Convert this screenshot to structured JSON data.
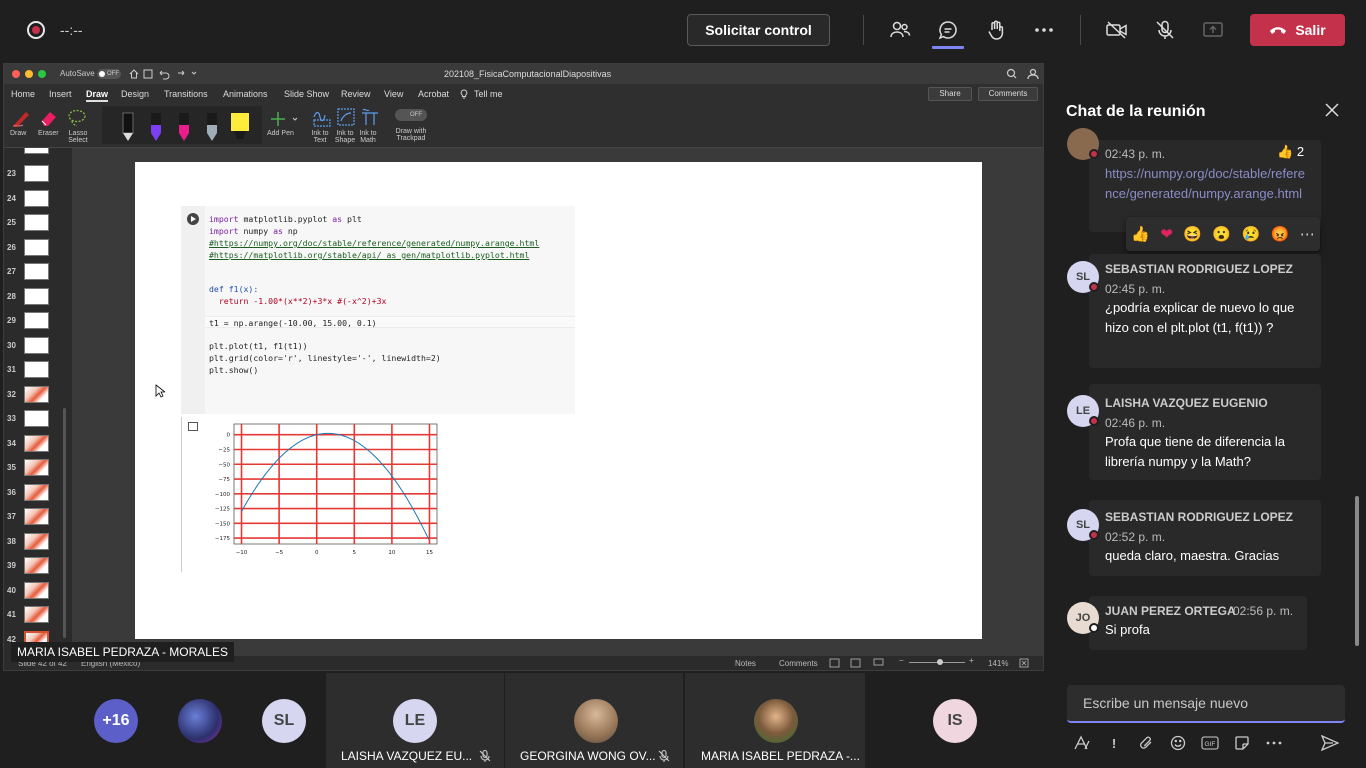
{
  "topbar": {
    "timer": "--:--",
    "request_control": "Solicitar control",
    "leave": "Salir",
    "icons": [
      "participants-icon",
      "chat-icon",
      "raise-hand-icon",
      "more-icon",
      "camera-off-icon",
      "mic-off-icon",
      "share-icon",
      "phone-hangup-icon"
    ]
  },
  "ppt": {
    "autosave": "AutoSave",
    "autosave_state": "OFF",
    "doc_title": "202108_FisicaComputacionalDiapositivas",
    "tabs": [
      "Home",
      "Insert",
      "Draw",
      "Design",
      "Transitions",
      "Animations",
      "Slide Show",
      "Review",
      "View",
      "Acrobat",
      "Tell me"
    ],
    "active_tab": "Draw",
    "share": "Share",
    "comments": "Comments",
    "ribbon": {
      "draw": "Draw",
      "eraser": "Eraser",
      "lasso": "Lasso Select",
      "add_pen": "Add Pen",
      "ink_text": "Ink to Text",
      "ink_shape": "Ink to Shape",
      "ink_math": "Ink to Math",
      "trackpad_state": "OFF",
      "trackpad": "Draw with Trackpad"
    },
    "thumb_numbers": [
      "23",
      "24",
      "25",
      "26",
      "27",
      "28",
      "29",
      "30",
      "31",
      "32",
      "33",
      "34",
      "35",
      "36",
      "37",
      "38",
      "39",
      "40",
      "41",
      "42"
    ],
    "status": {
      "slide": "Slide 42 of 42",
      "lang": "English (México)",
      "notes": "Notes",
      "comments": "Comments",
      "zoom": "141%"
    }
  },
  "code": {
    "lines": [
      [
        "import",
        " matplotlib.pyplot ",
        "as",
        " plt"
      ],
      [
        "import",
        " numpy ",
        "as",
        " np"
      ]
    ],
    "link1": "#https://numpy.org/doc/stable/reference/generated/numpy.arange.html",
    "link2": "#https://matplotlib.org/stable/api/_as_gen/matplotlib.pyplot.html",
    "def_line": "def f1(x):",
    "return_line": "  return -1.00*(x**2)+3*x #(-x^2)+3x",
    "t1_line": "t1 = np.arange(-10.00, 15.00, 0.1)",
    "plot_line": "plt.plot(t1, f1(t1))",
    "grid_line": "plt.grid(color='r', linestyle='-', linewidth=2)",
    "show_line": "plt.show()"
  },
  "chart_data": {
    "type": "line",
    "series": [
      {
        "x": [
          -10,
          -7.5,
          -5,
          -2.5,
          0,
          1.5,
          2.5,
          5,
          7.5,
          10,
          12.5,
          14.9
        ],
        "y": [
          -130,
          -78.75,
          -40,
          -13.75,
          0,
          2.25,
          1.25,
          -10,
          -33.75,
          -70,
          -118.75,
          -177.31
        ]
      }
    ],
    "xticks": [
      "−10",
      "−5",
      "0",
      "5",
      "10",
      "15"
    ],
    "yticks": [
      "0",
      "−25",
      "−50",
      "−75",
      "−100",
      "−125",
      "−150",
      "−175"
    ],
    "xlim": [
      -11,
      16
    ],
    "ylim": [
      -185,
      8
    ],
    "grid": true,
    "grid_color": "#e53935",
    "line_color": "#1f77b4"
  },
  "presenter_tag": "MARIA ISABEL PEDRAZA - MORALES",
  "chat": {
    "title": "Chat de la reunión",
    "first_msg": {
      "time": "02:43 p. m.",
      "reaction_count": "2",
      "link": "https://numpy.org/doc/stable/reference/generated/numpy.arange.html"
    },
    "reactions": [
      "👍",
      "❤",
      "😆",
      "😮",
      "😢",
      "😡",
      "⋯"
    ],
    "messages": [
      {
        "initials": "SL",
        "name": "SEBASTIAN RODRIGUEZ LOPEZ",
        "time": "02:45 p. m.",
        "text": "¿podría explicar de nuevo lo que hizo con el plt.plot (t1, f(t1)) ?"
      },
      {
        "initials": "LE",
        "name": "LAISHA VAZQUEZ EUGENIO",
        "time": "02:46 p. m.",
        "text": "Profa que tiene de diferencia la librería numpy y la Math?"
      },
      {
        "initials": "SL",
        "name": "SEBASTIAN RODRIGUEZ LOPEZ",
        "time": "02:52 p. m.",
        "text": "queda claro, maestra. Gracias"
      },
      {
        "initials": "JO",
        "name": "JUAN PEREZ ORTEGA",
        "time": "02:56 p. m.",
        "text": "Si profa"
      }
    ],
    "compose_placeholder": "Escribe un mensaje nuevo"
  },
  "participants": {
    "overflow": "+16",
    "tiles": [
      {
        "initials": "SL",
        "name": ""
      },
      {
        "initials": "LE",
        "name": "LAISHA VAZQUEZ EU..."
      },
      {
        "initials": "",
        "name": "GEORGINA WONG OV..."
      },
      {
        "initials": "",
        "name": "MARIA ISABEL PEDRAZA -..."
      },
      {
        "initials": "IS",
        "name": ""
      }
    ]
  },
  "colors": {
    "accent": "#7f85f5",
    "leave": "#c4314b",
    "link": "#8b8cc7"
  }
}
